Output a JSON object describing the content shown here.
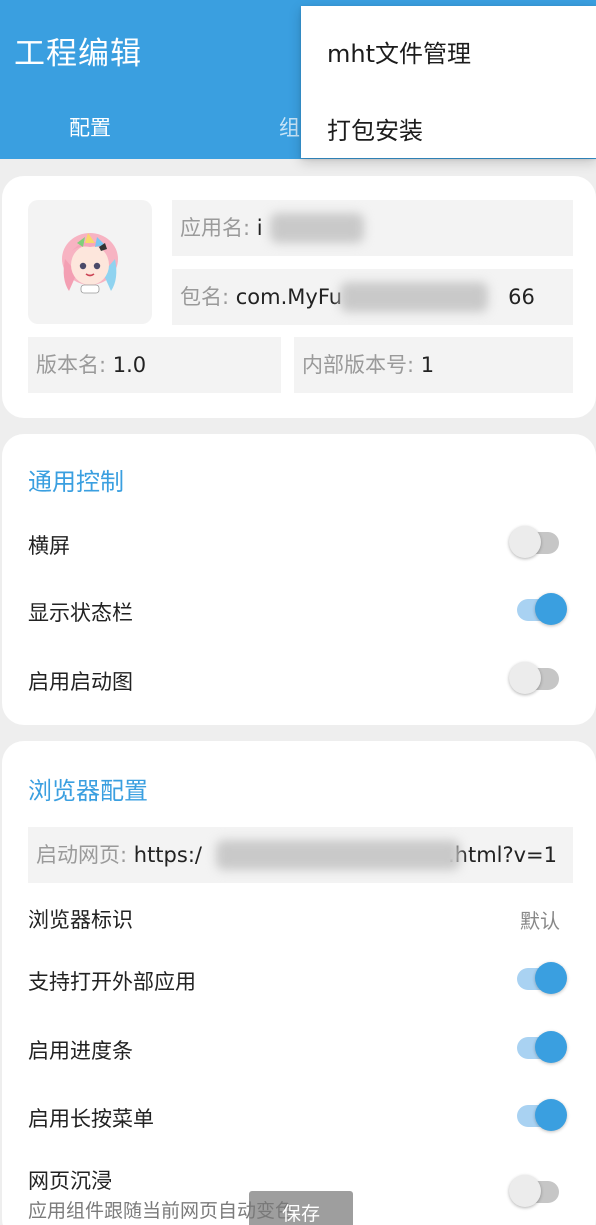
{
  "appbar": {
    "title": "工程编辑",
    "tabs": [
      {
        "label": "配置"
      },
      {
        "label": "组"
      }
    ]
  },
  "popup_menu": {
    "items": [
      {
        "label": "mht文件管理"
      },
      {
        "label": "打包安装"
      }
    ]
  },
  "app_info": {
    "app_name_label": "应用名: ",
    "app_name_value": "i",
    "package_label": "包名: ",
    "package_value_prefix": "com.MyFu",
    "package_value_suffix": "66",
    "version_name_label": "版本名: ",
    "version_name_value": "1.0",
    "version_code_label": "内部版本号: ",
    "version_code_value": "1"
  },
  "general": {
    "title": "通用控制",
    "rows": [
      {
        "label": "横屏",
        "on": false
      },
      {
        "label": "显示状态栏",
        "on": true
      },
      {
        "label": "启用启动图",
        "on": false
      }
    ]
  },
  "browser": {
    "title": "浏览器配置",
    "start_page_label": "启动网页: ",
    "start_page_prefix": "https:/",
    "start_page_suffix": ".html?v=1",
    "user_agent_label": "浏览器标识",
    "user_agent_value": "默认",
    "rows": [
      {
        "label": "支持打开外部应用",
        "on": true
      },
      {
        "label": "启用进度条",
        "on": true
      },
      {
        "label": "启用长按菜单",
        "on": true
      },
      {
        "label": "网页沉浸",
        "on": false
      }
    ],
    "immersive_sub": "应用组件跟随当前网页自动变色"
  },
  "toast": {
    "text": "保存"
  },
  "colors": {
    "accent": "#3a9fe0",
    "switch_on_track": "#a9d2f2",
    "switch_off_track": "#c6c6c6"
  }
}
